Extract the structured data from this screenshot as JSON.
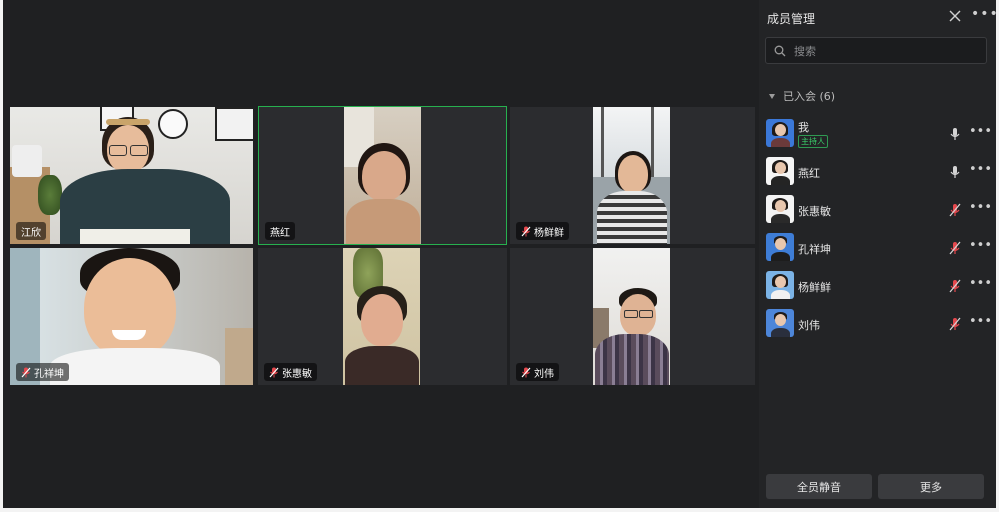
{
  "tiles": [
    {
      "name": "江欣"
    },
    {
      "name": "燕红"
    },
    {
      "name": "杨鲜鲜"
    },
    {
      "name": "孔祥坤"
    },
    {
      "name": "张惠敏"
    },
    {
      "name": "刘伟"
    }
  ],
  "panel": {
    "title": "成员管理",
    "search_placeholder": "搜索",
    "section_label": "已入会 (6)",
    "members": [
      {
        "name": "我",
        "badge": "主持人",
        "mic": "on"
      },
      {
        "name": "燕红",
        "mic": "on"
      },
      {
        "name": "张惠敏",
        "mic": "muted"
      },
      {
        "name": "孔祥坤",
        "mic": "muted"
      },
      {
        "name": "杨鲜鲜",
        "mic": "muted"
      },
      {
        "name": "刘伟",
        "mic": "muted"
      }
    ],
    "mute_all_label": "全员静音",
    "more_label": "更多"
  },
  "colors": {
    "background": "#1f2022",
    "active_border": "#27b04f",
    "host_badge": "#3ad06a",
    "muted_icon": "#e5484d"
  }
}
